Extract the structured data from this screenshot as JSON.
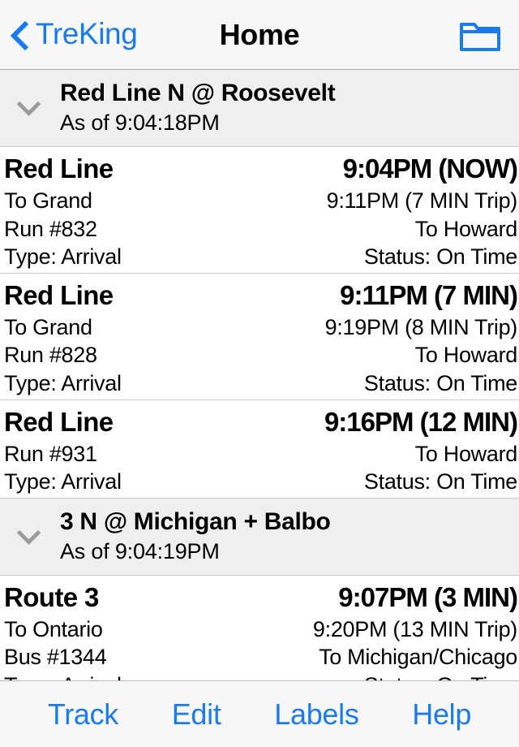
{
  "navbar": {
    "back_label": "TreKing",
    "back_icon": "chevron-left-icon",
    "title": "Home",
    "right_icon": "folder-icon"
  },
  "colors": {
    "accent_blue": "#1a7bf0",
    "section_header_bg": "#efeff0",
    "bar_bg": "#f7f7f7",
    "separator": "#c9c9c9",
    "chevron_gray": "#9b9b9b"
  },
  "sections": [
    {
      "title": "Red Line N @ Roosevelt",
      "subtitle": "As of 9:04:18PM",
      "collapse_icon": "chevron-down-icon",
      "rows": [
        {
          "route": "Red Line",
          "eta": "9:04PM (NOW)",
          "destination": "To Grand",
          "trip": "9:11PM (7 MIN Trip)",
          "run": "Run #832",
          "direction": "To Howard",
          "type": "Type: Arrival",
          "status": "Status: On Time"
        },
        {
          "route": "Red Line",
          "eta": "9:11PM (7 MIN)",
          "destination": "To Grand",
          "trip": "9:19PM (8 MIN Trip)",
          "run": "Run #828",
          "direction": "To Howard",
          "type": "Type: Arrival",
          "status": "Status: On Time"
        },
        {
          "route": "Red Line",
          "eta": "9:16PM (12 MIN)",
          "destination": "",
          "trip": "",
          "run": "Run #931",
          "direction": "To Howard",
          "type": "Type: Arrival",
          "status": "Status: On Time"
        }
      ]
    },
    {
      "title": "3 N @ Michigan + Balbo",
      "subtitle": "As of 9:04:19PM",
      "collapse_icon": "chevron-down-icon",
      "rows": [
        {
          "route": "Route 3",
          "eta": "9:07PM (3 MIN)",
          "destination": "To Ontario",
          "trip": "9:20PM (13 MIN Trip)",
          "run": "Bus #1344",
          "direction": "To Michigan/Chicago",
          "type": "Type: Arrival",
          "status": "Status: On Time"
        }
      ]
    }
  ],
  "toolbar": {
    "items": [
      {
        "label": "Track"
      },
      {
        "label": "Edit"
      },
      {
        "label": "Labels"
      },
      {
        "label": "Help"
      }
    ]
  }
}
